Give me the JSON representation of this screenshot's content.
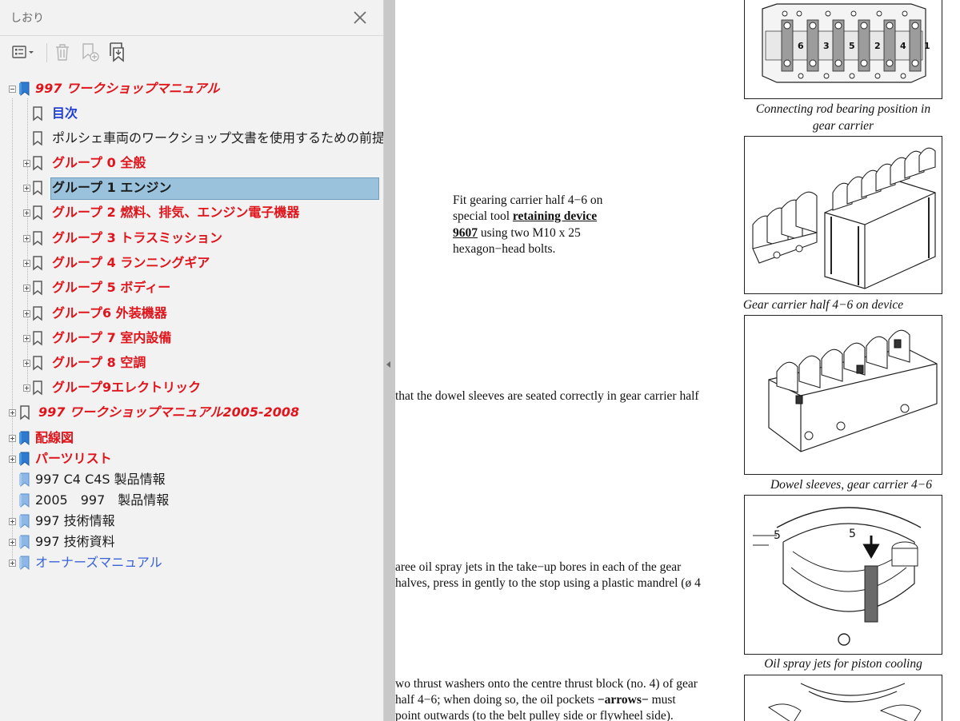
{
  "panel": {
    "title": "しおり",
    "toolbar": {
      "options_icon": "list-options-icon",
      "delete_icon": "trash-icon",
      "new_bookmark_icon": "bookmark-add-icon",
      "expand_icon": "expand-bookmark-icon"
    },
    "bookmarks": [
      {
        "label": "997  ワークショップマニュアル",
        "style": "red-i",
        "expanded": true
      },
      {
        "label": "目次",
        "style": "blue"
      },
      {
        "label": "ポルシェ車両のワークショップ文書を使用するための前提条件",
        "style": "black"
      },
      {
        "label": "グループ 0 全般",
        "style": "red"
      },
      {
        "label": "グループ 1 エンジン",
        "style": "black-bold",
        "selected": true
      },
      {
        "label": "グループ 2 燃料、排気、エンジン電子機器",
        "style": "red"
      },
      {
        "label": "グループ 3 トラスミッション",
        "style": "red"
      },
      {
        "label": "グループ 4 ランニングギア",
        "style": "red"
      },
      {
        "label": "グループ 5 ボディー",
        "style": "red"
      },
      {
        "label": "グループ6 外装機器",
        "style": "red"
      },
      {
        "label": "グループ 7 室内設備",
        "style": "red"
      },
      {
        "label": "グループ 8 空調",
        "style": "red"
      },
      {
        "label": "グループ9エレクトリック",
        "style": "red"
      },
      {
        "label": "997 ワークショップマニュアル2005-2008",
        "style": "red-i"
      },
      {
        "label": "配線図",
        "style": "red"
      },
      {
        "label": "パーツリスト",
        "style": "red"
      },
      {
        "label": "997 C4 C4S 製品情報",
        "style": "black"
      },
      {
        "label": "2005　997　製品情報",
        "style": "black"
      },
      {
        "label": "997 技術情報",
        "style": "black"
      },
      {
        "label": "997 技術資料",
        "style": "black"
      },
      {
        "label": "オーナーズマニュアル",
        "style": "blue-n"
      }
    ]
  },
  "document": {
    "fit_text": {
      "line1": "Fit gearing carrier half 4−6 on",
      "line2_pre": "special tool ",
      "line2_link": "retaining device",
      "line3_link": "9607",
      "line3_post": " using two M10 x 25",
      "line4": "hexagon−head bolts."
    },
    "dowel_text": "that the dowel sleeves are seated correctly in gear carrier half",
    "oil_text": {
      "line1": "aree oil spray jets in the take−up bores in each of the gear",
      "line2": "halves, press in gently to the stop using a plastic mandrel (ø 4"
    },
    "thrust_text": {
      "line1": "wo thrust washers onto the centre thrust block (no. 4) of gear",
      "line2_pre": "half 4−6; when doing so, the oil pockets ",
      "line2_bold": "−arrows−",
      "line2_post": " must",
      "line3": "point outwards (to the belt pulley side or flywheel side)."
    },
    "figures": [
      {
        "caption": "Connecting rod bearing position in gear carrier",
        "numbers": [
          "6",
          "3",
          "5",
          "2",
          "4",
          "1"
        ]
      },
      {
        "caption": "Gear carrier half 4−6 on device"
      },
      {
        "caption": "Dowel sleeves, gear carrier 4−6"
      },
      {
        "caption": "Oil spray jets for piston cooling",
        "marks": [
          "5",
          "5"
        ]
      }
    ]
  }
}
